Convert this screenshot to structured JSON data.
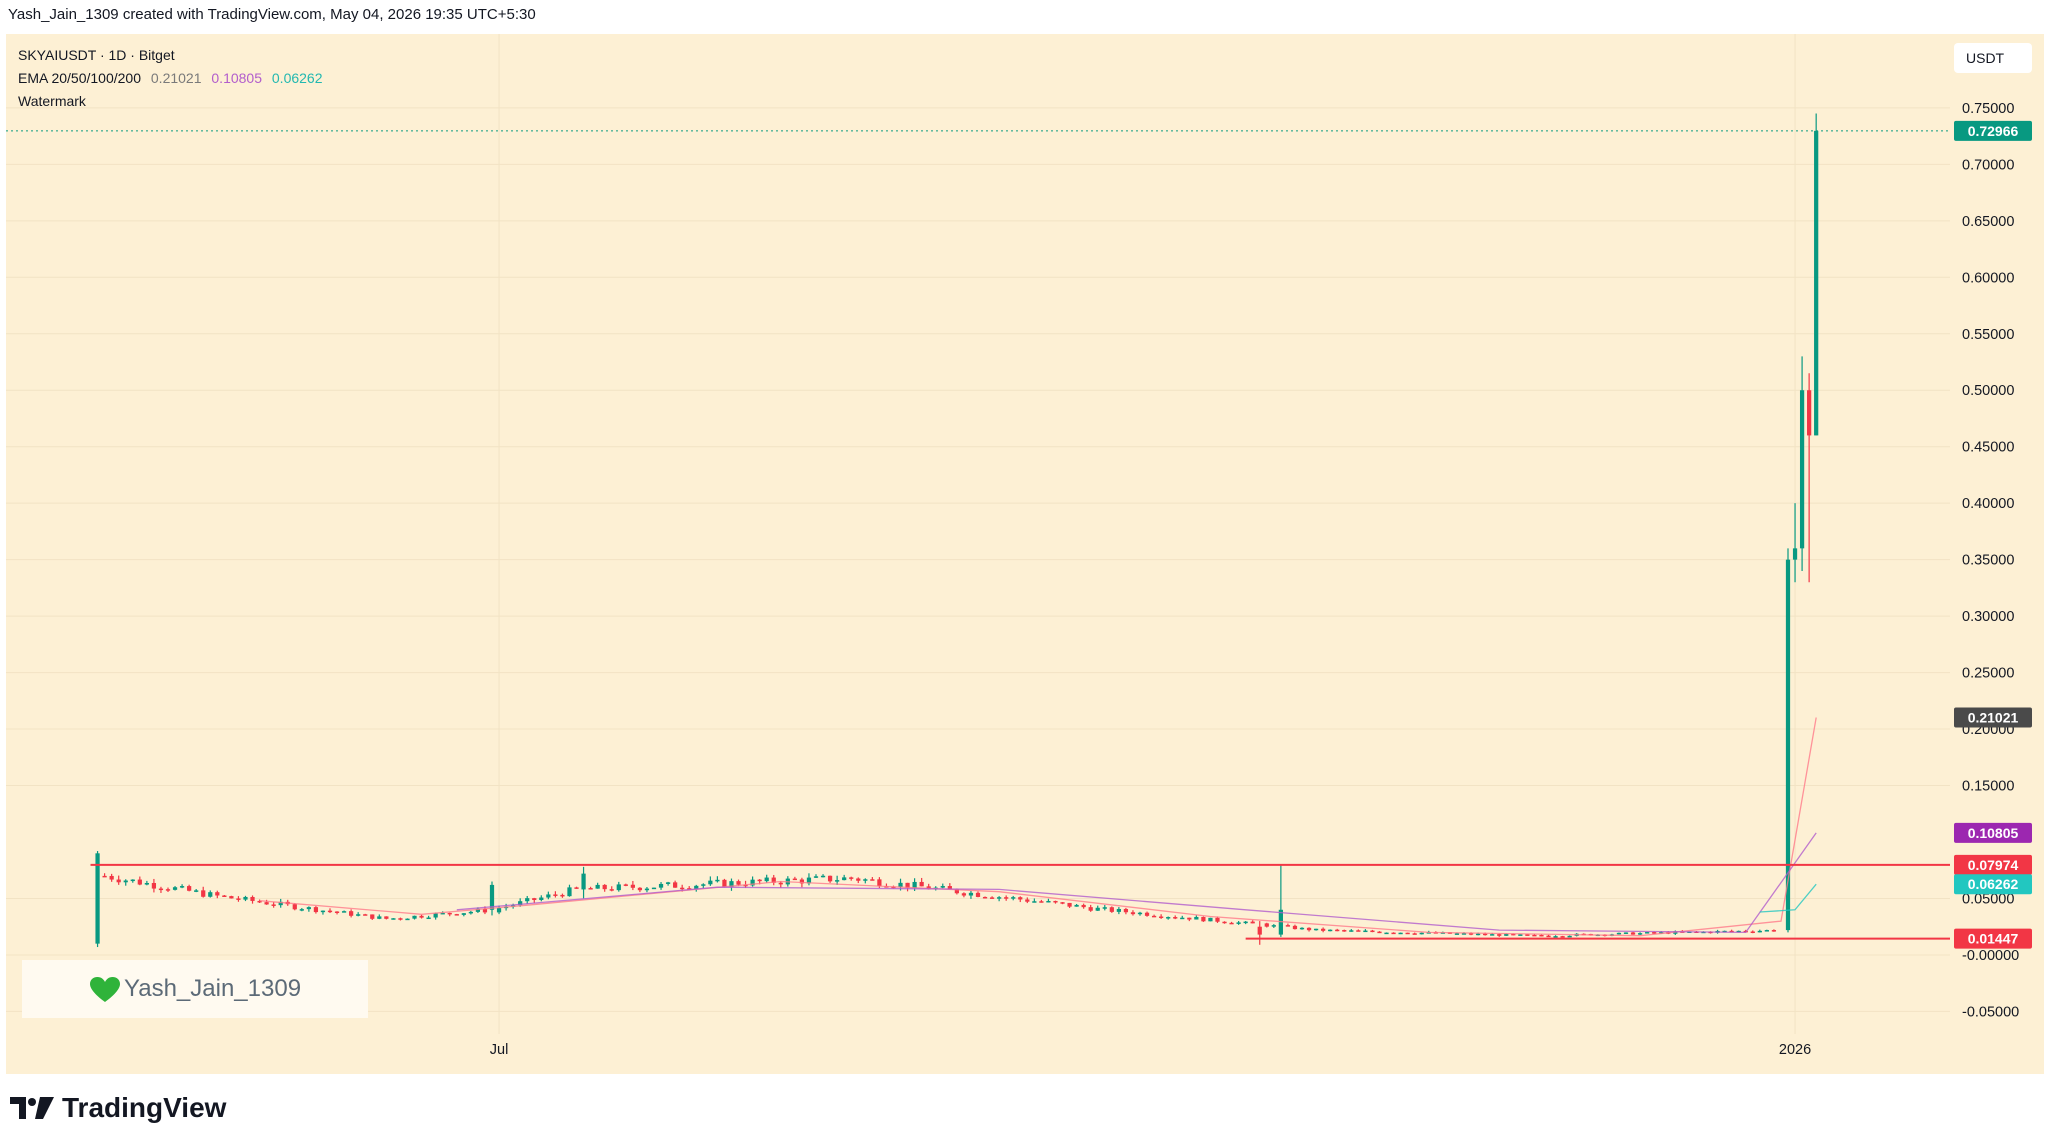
{
  "header": {
    "credit": "Yash_Jain_1309 created with TradingView.com, May 04, 2026 19:35 UTC+5:30"
  },
  "legend": {
    "symbol_line": "SKYAIUSDT · 1D · Bitget",
    "ema_label": "EMA 20/50/100/200",
    "ema_values": [
      "0.21021",
      "0.10805",
      "0.06262"
    ],
    "watermark_label": "Watermark"
  },
  "currency_label": "USDT",
  "watermark_text": "Yash_Jain_1309",
  "brand": {
    "name": "TradingView",
    "logo_icon": "tradingview-logo-icon"
  },
  "colors": {
    "background": "#fdf0d4",
    "up": "#089981",
    "down": "#f23645",
    "ema20": "#ff7b8a",
    "ema50": "#b25dcc",
    "ema200": "#22c7c0",
    "support_line": "#f23645"
  },
  "chart_data": {
    "type": "candlestick",
    "symbol": "SKYAIUSDT",
    "interval": "1D",
    "exchange": "Bitget",
    "y_axis": {
      "ylim": [
        -0.07,
        0.78
      ],
      "ticks": [
        "0.75000",
        "0.70000",
        "0.65000",
        "0.60000",
        "0.55000",
        "0.50000",
        "0.45000",
        "0.40000",
        "0.35000",
        "0.30000",
        "0.25000",
        "0.20000",
        "0.15000",
        "0.05000",
        "-0.00000",
        "-0.05000"
      ],
      "tick_values": [
        0.75,
        0.7,
        0.65,
        0.6,
        0.55,
        0.5,
        0.45,
        0.4,
        0.35,
        0.3,
        0.25,
        0.2,
        0.15,
        0.05,
        0.0,
        -0.05
      ],
      "position": "right"
    },
    "x_axis": {
      "labels": [
        {
          "text": "Jul",
          "date": "2025-07-01"
        },
        {
          "text": "2026",
          "date": "2026-01-01"
        }
      ],
      "start_date": "2025-04-22",
      "end_date": "2026-01-23"
    },
    "price_badges": [
      {
        "text": "0.72966",
        "value": 0.72966,
        "color": "#089981",
        "dotted_line": true
      },
      {
        "text": "0.21021",
        "value": 0.21021,
        "color": "#4a4a4a"
      },
      {
        "text": "0.10805",
        "value": 0.10805,
        "color": "#9c27b0"
      },
      {
        "text": "0.07974",
        "value": 0.07974,
        "color": "#f23645"
      },
      {
        "text": "0.06262",
        "value": 0.06262,
        "color": "#22c7c0"
      },
      {
        "text": "0.01447",
        "value": 0.01447,
        "color": "#f23645"
      }
    ],
    "horizontal_lines": [
      {
        "value": 0.07974,
        "from_date": "2025-05-04",
        "color": "#f23645"
      },
      {
        "value": 0.01447,
        "from_date": "2025-10-15",
        "color": "#f23645"
      }
    ],
    "grid": true,
    "legend_position": "top-left",
    "price_segments": [
      {
        "from_date": "2025-05-05",
        "to_date": "2025-05-06",
        "from_price": 0.09,
        "to_price": 0.07
      },
      {
        "from_date": "2025-05-06",
        "to_date": "2025-05-22",
        "from_price": 0.07,
        "to_price": 0.052
      },
      {
        "from_date": "2025-05-22",
        "to_date": "2025-06-15",
        "from_price": 0.052,
        "to_price": 0.032
      },
      {
        "from_date": "2025-06-15",
        "to_date": "2025-06-30",
        "from_price": 0.032,
        "to_price": 0.04
      },
      {
        "from_date": "2025-06-30",
        "to_date": "2025-07-12",
        "from_price": 0.04,
        "to_price": 0.058
      },
      {
        "from_date": "2025-07-12",
        "to_date": "2025-08-20",
        "from_price": 0.058,
        "to_price": 0.068
      },
      {
        "from_date": "2025-08-20",
        "to_date": "2025-09-25",
        "from_price": 0.068,
        "to_price": 0.04
      },
      {
        "from_date": "2025-09-25",
        "to_date": "2025-10-25",
        "from_price": 0.04,
        "to_price": 0.022
      },
      {
        "from_date": "2025-10-25",
        "to_date": "2025-11-25",
        "from_price": 0.022,
        "to_price": 0.017
      },
      {
        "from_date": "2025-11-25",
        "to_date": "2025-12-30",
        "from_price": 0.017,
        "to_price": 0.022
      }
    ],
    "noted_candles": [
      {
        "date": "2025-05-05",
        "open": 0.01,
        "high": 0.092,
        "low": 0.007,
        "close": 0.09
      },
      {
        "date": "2025-06-30",
        "open": 0.04,
        "high": 0.065,
        "low": 0.035,
        "close": 0.062
      },
      {
        "date": "2025-07-13",
        "open": 0.058,
        "high": 0.078,
        "low": 0.05,
        "close": 0.072
      },
      {
        "date": "2025-10-17",
        "open": 0.025,
        "high": 0.03,
        "low": 0.009,
        "close": 0.018
      },
      {
        "date": "2025-10-20",
        "open": 0.018,
        "high": 0.08,
        "low": 0.016,
        "close": 0.04
      },
      {
        "date": "2025-12-31",
        "open": 0.022,
        "high": 0.36,
        "low": 0.02,
        "close": 0.35
      },
      {
        "date": "2026-01-01",
        "open": 0.35,
        "high": 0.4,
        "low": 0.33,
        "close": 0.36
      },
      {
        "date": "2026-01-02",
        "open": 0.36,
        "high": 0.53,
        "low": 0.34,
        "close": 0.5
      },
      {
        "date": "2026-01-03",
        "open": 0.5,
        "high": 0.515,
        "low": 0.33,
        "close": 0.46
      },
      {
        "date": "2026-01-04",
        "open": 0.46,
        "high": 0.745,
        "low": 0.46,
        "close": 0.72966
      }
    ],
    "ema_lines": [
      {
        "name": "EMA 20",
        "color": "#ff7b8a",
        "points": [
          [
            "2025-05-28",
            0.048
          ],
          [
            "2025-06-20",
            0.036
          ],
          [
            "2025-07-05",
            0.044
          ],
          [
            "2025-08-10",
            0.065
          ],
          [
            "2025-09-10",
            0.056
          ],
          [
            "2025-10-10",
            0.034
          ],
          [
            "2025-11-10",
            0.02
          ],
          [
            "2025-12-10",
            0.017
          ],
          [
            "2025-12-30",
            0.03
          ],
          [
            "2026-01-04",
            0.21021
          ]
        ]
      },
      {
        "name": "EMA 50",
        "color": "#b25dcc",
        "points": [
          [
            "2025-06-25",
            0.04
          ],
          [
            "2025-08-01",
            0.06
          ],
          [
            "2025-09-10",
            0.058
          ],
          [
            "2025-10-15",
            0.04
          ],
          [
            "2025-11-20",
            0.022
          ],
          [
            "2025-12-25",
            0.02
          ],
          [
            "2026-01-04",
            0.10805
          ]
        ]
      },
      {
        "name": "EMA 200",
        "color": "#22c7c0",
        "points": [
          [
            "2025-12-27",
            0.038
          ],
          [
            "2026-01-01",
            0.04
          ],
          [
            "2026-01-04",
            0.06262
          ]
        ]
      }
    ]
  }
}
